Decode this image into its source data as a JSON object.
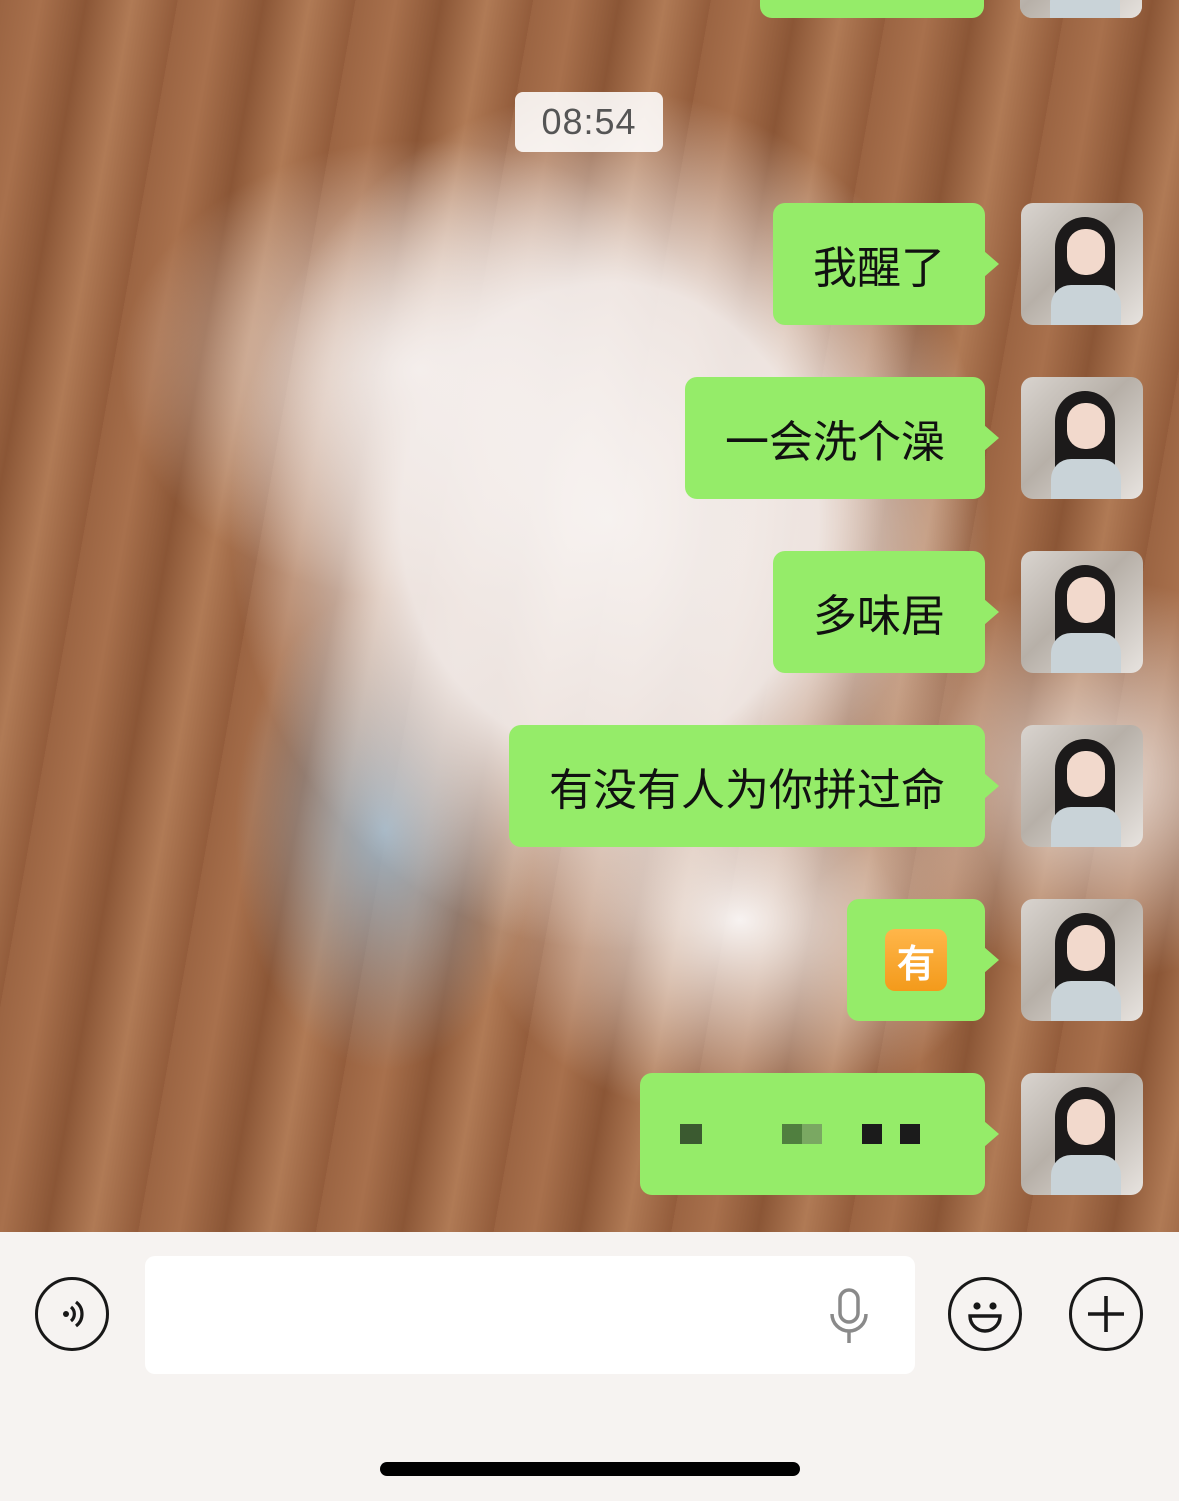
{
  "chat": {
    "timestamp": "08:54",
    "messages": [
      {
        "sender": "me",
        "text": "我醒了"
      },
      {
        "sender": "me",
        "text": "一会洗个澡"
      },
      {
        "sender": "me",
        "text": "多味居"
      },
      {
        "sender": "me",
        "text": "有没有人为你拼过命"
      },
      {
        "sender": "me",
        "type": "emoji",
        "emoji_char": "有"
      },
      {
        "sender": "me",
        "type": "redacted"
      }
    ]
  },
  "input_bar": {
    "voice_toggle_icon": "voice-wave-icon",
    "text_field_value": "",
    "mic_icon": "microphone-icon",
    "emoji_icon": "smiley-face-icon",
    "plus_icon": "plus-icon"
  },
  "colors": {
    "bubble_sent": "#95ec69",
    "toolbar_bg": "#f6f3f1",
    "icon_stroke": "#181818"
  }
}
